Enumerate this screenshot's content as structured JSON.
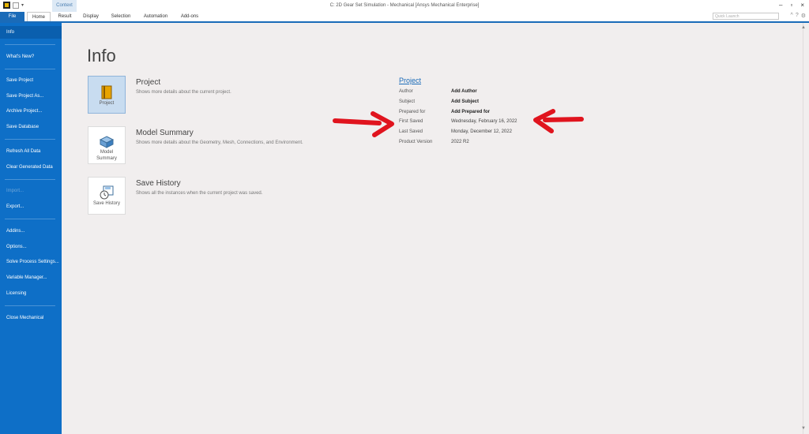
{
  "window": {
    "title": "C: 2D Gear Set Simulation - Mechanical [Ansys Mechanical Enterprise]",
    "context_tab": "Context",
    "controls": {
      "minimize": "–",
      "restore": "▫",
      "close": "×"
    }
  },
  "ribbon": {
    "tabs": [
      "File",
      "Home",
      "Result",
      "Display",
      "Selection",
      "Automation",
      "Add-ons"
    ],
    "quick_launch_placeholder": "Quick Launch",
    "right_icons": [
      "^",
      "?",
      "⚙"
    ]
  },
  "sidebar": {
    "items": [
      {
        "label": "Info",
        "active": true
      },
      {
        "label": "What's New?"
      },
      {
        "label": "Save Project"
      },
      {
        "label": "Save Project As..."
      },
      {
        "label": "Archive Project..."
      },
      {
        "label": "Save Database"
      },
      {
        "label": "Refresh All Data"
      },
      {
        "label": "Clear Generated Data"
      },
      {
        "label": "Import...",
        "disabled": true
      },
      {
        "label": "Export..."
      },
      {
        "label": "Addins..."
      },
      {
        "label": "Options..."
      },
      {
        "label": "Solve Process Settings..."
      },
      {
        "label": "Variable Manager..."
      },
      {
        "label": "Licensing"
      },
      {
        "label": "Close Mechanical"
      }
    ]
  },
  "main": {
    "title": "Info",
    "cards": [
      {
        "icon_label": "Project",
        "title": "Project",
        "desc": "Shows more details about the current project."
      },
      {
        "icon_label": "Model Summary",
        "title": "Model Summary",
        "desc": "Shows more details about the Geometry, Mesh, Connections, and Environment."
      },
      {
        "icon_label": "Save History",
        "title": "Save History",
        "desc": "Shows all the instances when the current project was saved."
      }
    ]
  },
  "project_props": {
    "heading": "Project",
    "rows": [
      {
        "label": "Author",
        "value": "Add Author"
      },
      {
        "label": "Subject",
        "value": "Add Subject"
      },
      {
        "label": "Prepared for",
        "value": "Add Prepared for"
      },
      {
        "label": "First Saved",
        "value": "Wednesday, February 16, 2022"
      },
      {
        "label": "Last Saved",
        "value": "Monday, December 12, 2022"
      },
      {
        "label": "Product Version",
        "value": "2022 R2"
      }
    ]
  },
  "colors": {
    "accent": "#1a6bb8",
    "sidebar": "#0e6fc7",
    "arrow": "#e0141e"
  }
}
